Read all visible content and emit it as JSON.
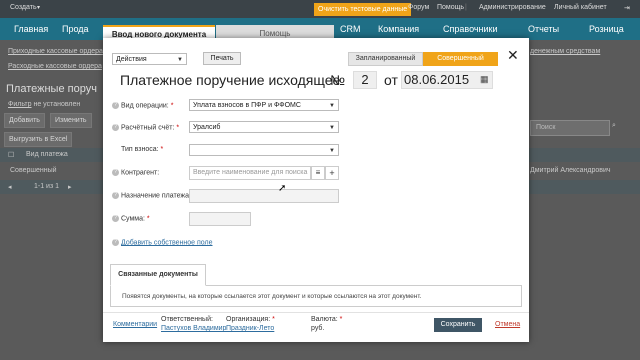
{
  "topbar": {
    "create": "Создать",
    "clear_test": "Очистить тестовые данные",
    "forum": "Форум",
    "help": "Помощь",
    "admin": "Администрирование",
    "cabinet": "Личный кабинет"
  },
  "nav": {
    "items": [
      "Главная",
      "Прода",
      "CRM",
      "Компания",
      "Справочники",
      "Отчеты",
      "Розница"
    ]
  },
  "bg": {
    "link1": "Приходные кассовые ордера",
    "link2": "Расходные кассовые ордера",
    "right_link": "денежным средствам",
    "title": "Платежные поруч",
    "filter_label": "Фильтр",
    "filter_value": "не установлен",
    "add": "Добавить",
    "change": "Изменить",
    "export": "Выгрузить в Excel",
    "col_type": "Вид платежа",
    "row1_type": "Совершенный",
    "row1_person": "Дмитрий Александрович",
    "pager": "1-1 из 1",
    "search_placeholder": "Поиск"
  },
  "modal": {
    "tab_new": "Ввод нового документа",
    "tab_help": "Помощь",
    "actions": "Действия",
    "print": "Печать",
    "status_planned": "Запланированный",
    "status_done": "Совершенный",
    "doc_title": "Платежное поручение исходящее",
    "num_sign": "№",
    "number": "2",
    "from": "от",
    "date": "08.06.2015",
    "op_type_label": "Вид операции:",
    "op_type_value": "Уплата взносов в ПФР и ФФОМС",
    "account_label": "Расчётный счёт:",
    "account_value": "Уралсиб",
    "fee_type_label": "Тип взноса:",
    "fee_type_value": "",
    "counterparty_label": "Контрагент:",
    "counterparty_placeholder": "Введите наименование для поиска",
    "purpose_label": "Назначение платежа:",
    "amount_label": "Сумма:",
    "add_field": "Добавить собственное поле",
    "related_tab": "Связанные документы",
    "related_text": "Появятся документы, на которые ссылается этот документ и которые ссылаются на этот документ.",
    "comments": "Комментарии",
    "responsible_label": "Ответственный:",
    "responsible_value": "Пастухов Владимир",
    "org_label": "Организация:",
    "org_value": "Праздник-Лето",
    "currency_label": "Валюта:",
    "currency_value": "руб.",
    "save": "Сохранить",
    "cancel": "Отмена",
    "required_mark": "*"
  }
}
